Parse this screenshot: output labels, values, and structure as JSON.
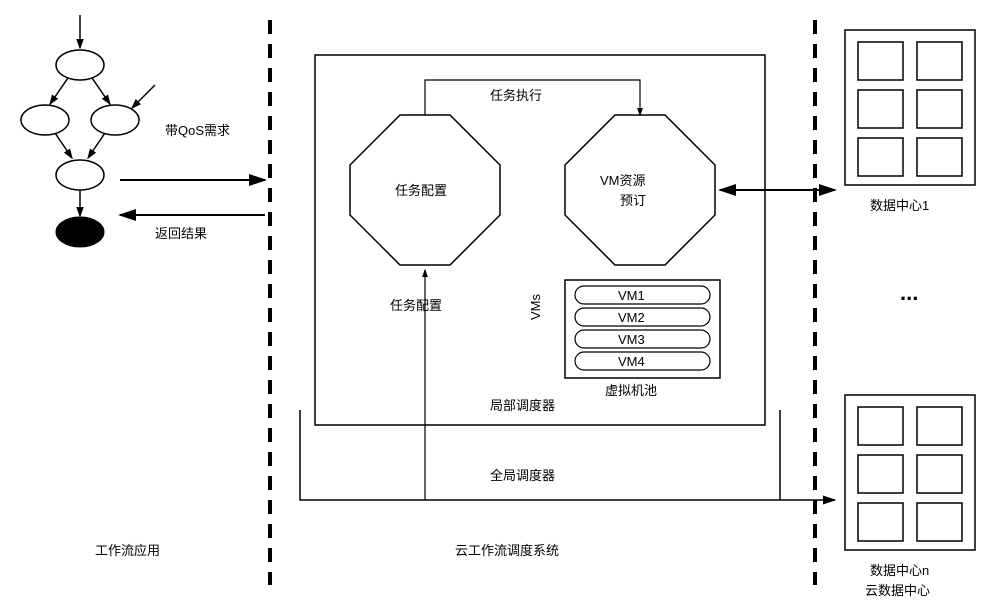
{
  "left_section_label": "工作流应用",
  "qos_label": "带QoS需求",
  "result_label": "返回结果",
  "center_section_label": "云工作流调度系统",
  "outer_box_label": "全局调度器",
  "inner_box_label": "局部调度器",
  "left_oct_label": "任务配置",
  "right_oct_top": "VM资源",
  "right_oct_bottom": "预订",
  "vms_label": "VMs",
  "vm_pool_label": "虚拟机池",
  "vm1": "VM1",
  "vm2": "VM2",
  "vm3": "VM3",
  "vm4": "VM4",
  "task_exec_label": "任务执行",
  "right_section_label": "云数据中心",
  "datacenter1_label": "数据中心1",
  "datacenter_n_label": "数据中心n",
  "ellipsis": "..."
}
